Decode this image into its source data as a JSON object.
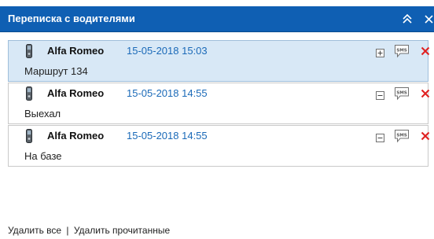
{
  "header": {
    "title": "Переписка с водителями",
    "collapse_icon": "double-chevron-up-icon",
    "close_icon": "close-icon",
    "background": "#0f5fb3"
  },
  "messages": [
    {
      "sender": "Alfa Romeo",
      "time": "15-05-2018 15:03",
      "text": "Маршрут 134",
      "expand_icon": "plus-square-icon",
      "selected": true
    },
    {
      "sender": "Alfa Romeo",
      "time": "15-05-2018 14:55",
      "text": "Выехал",
      "expand_icon": "minus-square-icon",
      "selected": false
    },
    {
      "sender": "Alfa Romeo",
      "time": "15-05-2018 14:55",
      "text": "На базе",
      "expand_icon": "minus-square-icon",
      "selected": false
    }
  ],
  "icons": {
    "phone": "phone-icon",
    "sms_label": "SMS",
    "delete": "delete-x-icon"
  },
  "colors": {
    "time_link": "#1b6ab8",
    "delete_red": "#e02020",
    "selected_row": "#d8e8f6"
  },
  "footer": {
    "delete_all": "Удалить все",
    "separator": "|",
    "delete_read": "Удалить прочитанные"
  }
}
